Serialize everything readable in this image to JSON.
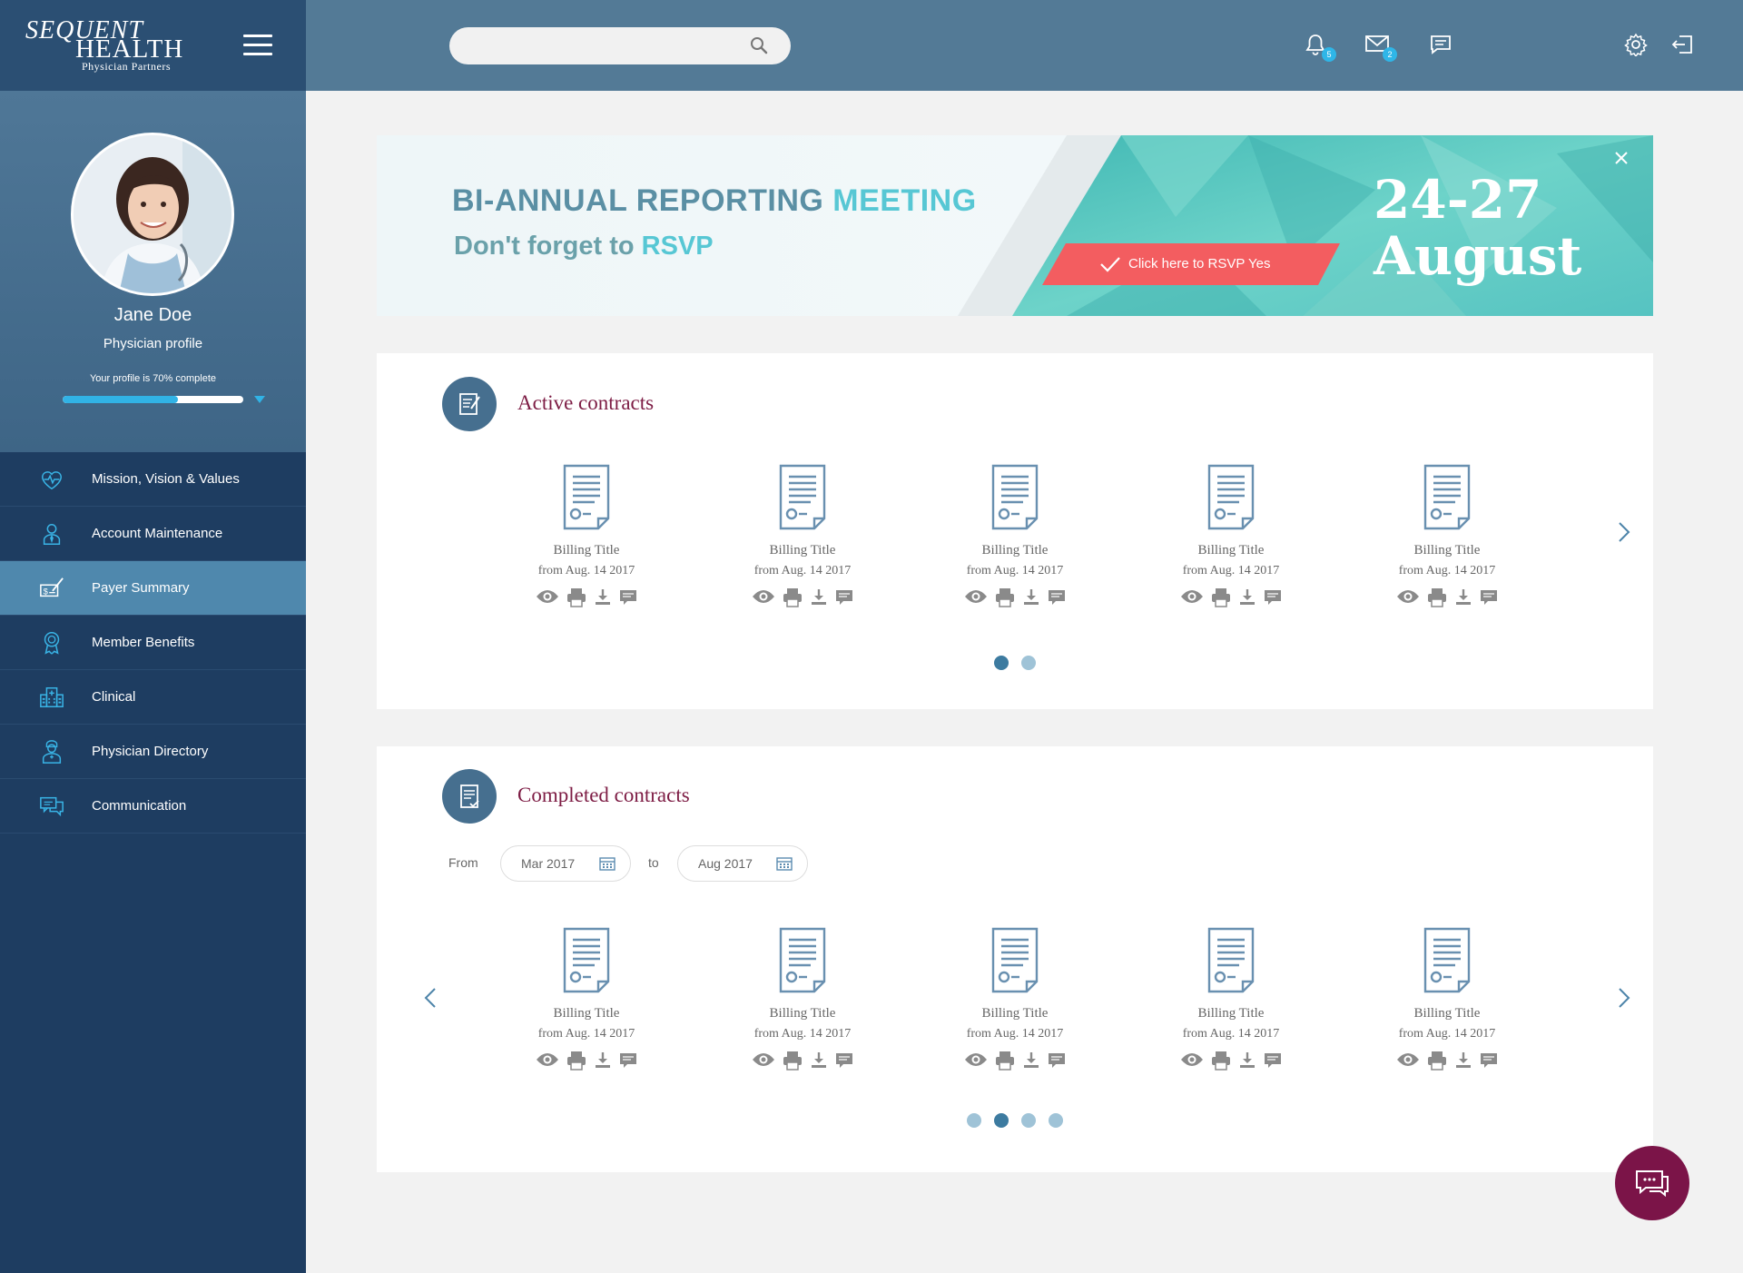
{
  "brand": {
    "line1": "SEQUENT",
    "line2": "HEALTH",
    "line3": "Physician Partners"
  },
  "search": {
    "placeholder": ""
  },
  "header": {
    "notifications_count": "5",
    "messages_count": "2"
  },
  "profile": {
    "name": "Jane Doe",
    "role": "Physician profile",
    "completion_text": "Your profile is 70% complete",
    "completion_value": 0.64
  },
  "nav": [
    {
      "label": "Mission, Vision & Values",
      "icon": "heart-pulse-icon",
      "active": false
    },
    {
      "label": "Account Maintenance",
      "icon": "user-tie-icon",
      "active": false
    },
    {
      "label": "Payer Summary",
      "icon": "check-sign-icon",
      "active": true
    },
    {
      "label": "Member Benefits",
      "icon": "award-ribbon-icon",
      "active": false
    },
    {
      "label": "Clinical",
      "icon": "hospital-building-icon",
      "active": false
    },
    {
      "label": "Physician Directory",
      "icon": "doctor-icon",
      "active": false
    },
    {
      "label": "Communication",
      "icon": "chat-bubbles-icon",
      "active": false
    }
  ],
  "banner": {
    "title_part1": "BI-ANNUAL REPORTING ",
    "title_part2": "MEETING",
    "subtitle_part1": "Don't forget to ",
    "subtitle_part2": "RSVP",
    "rsvp_label": "Click here to RSVP Yes",
    "date_line1": "24-27",
    "date_line2": "August",
    "colors": {
      "teal": "#5ccbc4",
      "rsvp": "#f25c5f"
    }
  },
  "active_contracts": {
    "title": "Active contracts",
    "items": [
      {
        "title": "Billing Title",
        "date": "from Aug. 14 2017"
      },
      {
        "title": "Billing Title",
        "date": "from Aug. 14 2017"
      },
      {
        "title": "Billing Title",
        "date": "from Aug. 14 2017"
      },
      {
        "title": "Billing Title",
        "date": "from Aug. 14 2017"
      },
      {
        "title": "Billing Title",
        "date": "from Aug. 14 2017"
      }
    ],
    "pages": 2,
    "current_page": 1
  },
  "completed_contracts": {
    "title": "Completed contracts",
    "from_label": "From",
    "from_value": "Mar 2017",
    "to_label": "to",
    "to_value": "Aug 2017",
    "items": [
      {
        "title": "Billing Title",
        "date": "from Aug. 14 2017"
      },
      {
        "title": "Billing Title",
        "date": "from Aug. 14 2017"
      },
      {
        "title": "Billing Title",
        "date": "from Aug. 14 2017"
      },
      {
        "title": "Billing Title",
        "date": "from Aug. 14 2017"
      },
      {
        "title": "Billing Title",
        "date": "from Aug. 14 2017"
      }
    ],
    "pages": 4,
    "current_page": 2
  },
  "colors": {
    "accent": "#31b3e6",
    "brand_dark": "#1e3d61",
    "title": "#7d1c44",
    "chat_fab": "#7b1448"
  }
}
